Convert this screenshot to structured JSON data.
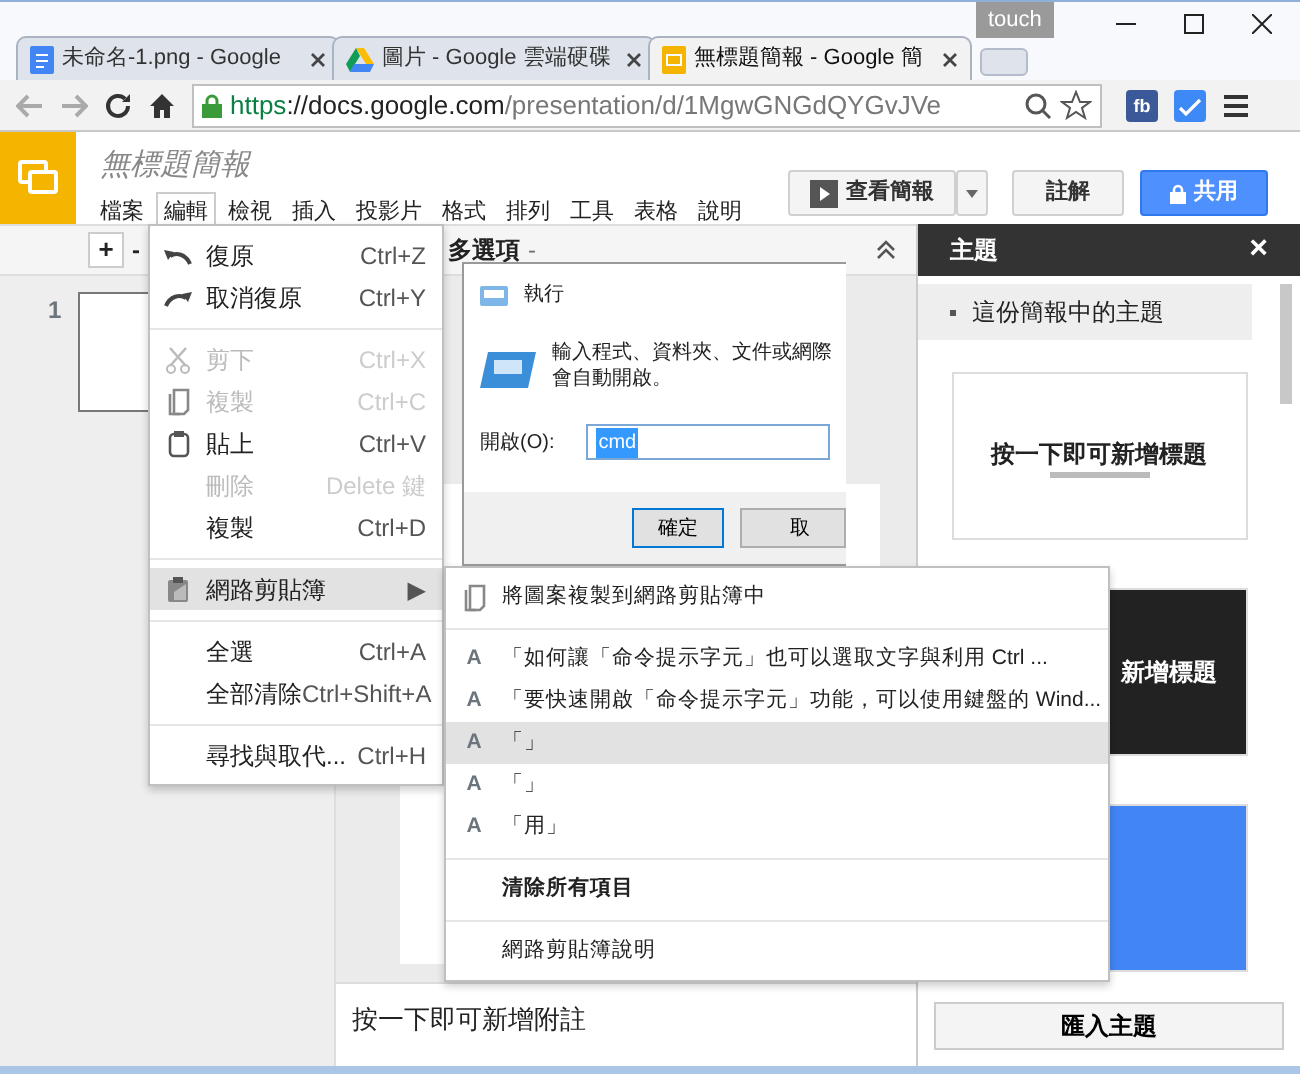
{
  "browser": {
    "tabs": [
      {
        "title": "未命名-1.png - Google",
        "kind": "doc",
        "selected": false
      },
      {
        "title": "圖片 - Google 雲端硬碟",
        "kind": "drive",
        "selected": false
      },
      {
        "title": "無標題簡報 - Google 簡",
        "kind": "slides",
        "selected": true
      }
    ],
    "badge": "touch",
    "url": {
      "scheme": "https",
      "host": "://docs.google.com",
      "path": "/presentation/d/1MgwGNGdQYGvJVe"
    },
    "extension": "fb"
  },
  "app": {
    "title": "無標題簡報",
    "menus": [
      {
        "label": "檔案",
        "selected": false
      },
      {
        "label": "編輯",
        "selected": true
      },
      {
        "label": "檢視",
        "selected": false
      },
      {
        "label": "插入",
        "selected": false
      },
      {
        "label": "投影片",
        "selected": false
      },
      {
        "label": "格式",
        "selected": false
      },
      {
        "label": "排列",
        "selected": false
      },
      {
        "label": "工具",
        "selected": false
      },
      {
        "label": "表格",
        "selected": false
      },
      {
        "label": "說明",
        "selected": false
      }
    ],
    "present_button": "查看簡報",
    "comments_button": "註解",
    "share_button": "共用"
  },
  "toolbar": {
    "add": "+",
    "zoom_out": "-",
    "more": "多選項",
    "more_caret": "-"
  },
  "filmstrip": {
    "slide_number": "1"
  },
  "theme_panel": {
    "title": "主題",
    "close": "×",
    "section": "這份簡報中的主題",
    "themes": [
      {
        "kind": "light",
        "title": "按一下即可新增標題"
      },
      {
        "kind": "dark",
        "title": "新增標題"
      },
      {
        "kind": "blue"
      }
    ],
    "import_button": "匯入主題"
  },
  "notes": {
    "placeholder": "按一下即可新增附註"
  },
  "run_dialog": {
    "title": "執行",
    "message": "輸入程式、資料夾、文件或網際",
    "message_2": "會自動開啟。",
    "open_label": "開啟(O):",
    "value": "cmd",
    "ok": "確定",
    "cancel": "取"
  },
  "edit_menu": {
    "items": [
      {
        "kind": "item",
        "label": "復原",
        "shortcut": "Ctrl+Z",
        "disabled": false,
        "selected": false
      },
      {
        "kind": "item",
        "label": "取消復原",
        "shortcut": "Ctrl+Y",
        "disabled": false,
        "selected": false
      },
      {
        "kind": "separator"
      },
      {
        "kind": "item",
        "label": "剪下",
        "shortcut": "Ctrl+X",
        "disabled": true,
        "selected": false
      },
      {
        "kind": "item",
        "label": "複製",
        "shortcut": "Ctrl+C",
        "disabled": true,
        "selected": false
      },
      {
        "kind": "item",
        "label": "貼上",
        "shortcut": "Ctrl+V",
        "disabled": false,
        "selected": false
      },
      {
        "kind": "item",
        "label": "刪除",
        "shortcut": "Delete 鍵",
        "disabled": true,
        "selected": false
      },
      {
        "kind": "item",
        "label": "複製",
        "shortcut": "Ctrl+D",
        "disabled": false,
        "selected": false
      },
      {
        "kind": "separator"
      },
      {
        "kind": "submenu",
        "label": "網路剪貼簿",
        "arrow": "▶",
        "disabled": false,
        "selected": true
      },
      {
        "kind": "separator"
      },
      {
        "kind": "item",
        "label": "全選",
        "shortcut": "Ctrl+A",
        "disabled": false,
        "selected": false
      },
      {
        "kind": "item",
        "label": "全部清除",
        "shortcut": "Ctrl+Shift+A",
        "disabled": false,
        "selected": false
      },
      {
        "kind": "separator"
      },
      {
        "kind": "item",
        "label": "尋找與取代...",
        "shortcut": "Ctrl+H",
        "disabled": false,
        "selected": false
      }
    ]
  },
  "clipboard_submenu": {
    "items": [
      {
        "kind": "action",
        "label": "將圖案複製到網路剪貼簿中",
        "selected": false
      },
      {
        "kind": "separator"
      },
      {
        "kind": "clip",
        "marker": "A",
        "label": "「如何讓「命令提示字元」也可以選取文字與利用 Ctrl ...",
        "selected": false
      },
      {
        "kind": "clip",
        "marker": "A",
        "label": "「要快速開啟「命令提示字元」功能，可以使用鍵盤的 Wind...",
        "selected": false
      },
      {
        "kind": "clip",
        "marker": "A",
        "label": "「」",
        "selected": true
      },
      {
        "kind": "clip",
        "marker": "A",
        "label": "「」",
        "selected": false
      },
      {
        "kind": "clip",
        "marker": "A",
        "label": "「用」",
        "selected": false
      },
      {
        "kind": "separator"
      },
      {
        "kind": "strong",
        "label": "清除所有項目",
        "selected": false
      },
      {
        "kind": "separator"
      },
      {
        "kind": "action",
        "label": "網路剪貼簿說明",
        "selected": false
      }
    ]
  }
}
